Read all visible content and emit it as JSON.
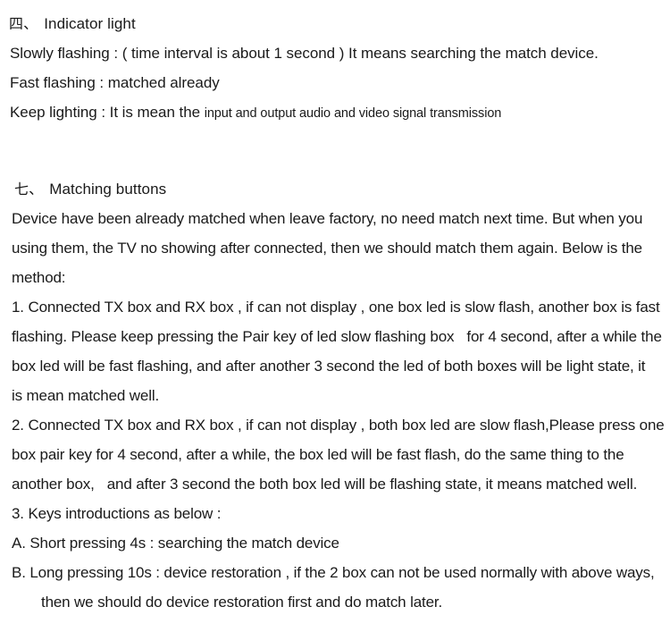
{
  "document": {
    "background_color": "#ffffff",
    "text_color": "#1a1a1a"
  },
  "sections": [
    {
      "id": "indicator-light",
      "heading_cn": "四、",
      "heading_text": "Indicator light",
      "lines": [
        {
          "id": "slowly-flashing",
          "text": "Slowly flashing : ( time interval is about  1 second ) It means   searching the match device."
        },
        {
          "id": "fast-flashing",
          "text": "Fast flashing : matched already"
        },
        {
          "id": "keep-lighting-main",
          "text": "Keep lighting : It is mean the ",
          "text_small": "input and output audio and video signal transmission"
        }
      ]
    },
    {
      "id": "matching-buttons",
      "heading_cn": "七、",
      "heading_text": "Matching buttons",
      "paragraphs": [
        {
          "id": "intro",
          "line1": "Device have been already matched when leave factory, no need match next time. But when you",
          "line2": "using them, the TV no showing after connected, then we should match them again. Below is the",
          "line3": "method:"
        },
        {
          "id": "step-1",
          "line1": "1.  Connected TX box and RX box , if can not display , one box led is slow flash, another box is fast",
          "line2a": "flashing. Please keep pressing the Pair key of led slow flashing box",
          "line2b": "for 4 second, after a while the",
          "line3": "box led will be fast flashing, and after another 3 second the led of both boxes will be light state, it",
          "line4": "is mean matched well."
        },
        {
          "id": "step-2",
          "line1": "2.  Connected TX box and RX box , if can not display , both box led are slow flash,Please press one",
          "line2": "box pair key for 4 second, after a while, the box led will be fast flash, do the same thing to the",
          "line3a": "another box,",
          "line3b": "and after 3 second the both box led will be flashing state, it means matched well."
        },
        {
          "id": "step-3",
          "line1": "3. Keys introductions as below :"
        },
        {
          "id": "key-a",
          "line1": "A. Short pressing 4s : searching the match device"
        },
        {
          "id": "key-b",
          "line1": "B. Long pressing 10s : device restoration , if the 2 box can not be used normally with above ways,",
          "line2": "then we should do device restoration first and do match later."
        }
      ]
    }
  ]
}
